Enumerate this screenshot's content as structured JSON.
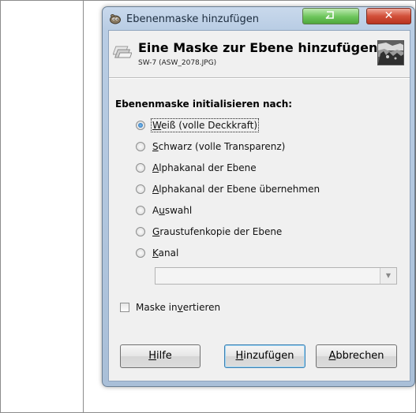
{
  "window": {
    "title": "Ebenenmaske hinzufügen",
    "close_glyph": "✕"
  },
  "header": {
    "title": "Eine Maske zur Ebene hinzufügen",
    "subtitle": "SW-7 (ASW_2078.JPG)"
  },
  "group_label": "Ebenenmaske initialisieren nach:",
  "options": [
    {
      "mnemonic": "W",
      "rest": "eiß (volle Deckkraft)",
      "checked": true
    },
    {
      "mnemonic": "S",
      "rest": "chwarz (volle Transparenz)",
      "checked": false
    },
    {
      "mnemonic": "A",
      "rest": "lphakanal der Ebene",
      "checked": false
    },
    {
      "mnemonic": "A",
      "rest": "lphakanal der Ebene übernehmen",
      "checked": false
    },
    {
      "pre": "A",
      "mnemonic": "u",
      "rest": "swahl",
      "checked": false
    },
    {
      "mnemonic": "G",
      "rest": "raustufenkopie der Ebene",
      "checked": false
    },
    {
      "mnemonic": "K",
      "rest": "anal",
      "checked": false
    }
  ],
  "channel_combo": {
    "value": "",
    "arrow": "▼"
  },
  "invert": {
    "pre": "Maske in",
    "mnemonic": "v",
    "rest": "ertieren",
    "checked": false
  },
  "buttons": {
    "help": {
      "mnemonic": "H",
      "rest": "ilfe"
    },
    "add": {
      "mnemonic": "H",
      "rest": "inzufügen"
    },
    "cancel": {
      "mnemonic": "A",
      "rest": "bbrechen"
    }
  },
  "colors": {
    "title_gradient_top": "#c9d9ec",
    "minimize_green": "#6cc45a",
    "close_red": "#d2503a",
    "radio_checked": "#1a5ea8"
  },
  "icons": {
    "app": "gimp-icon",
    "header": "layer-mask-icon",
    "thumbnail": "layer-thumbnail"
  }
}
